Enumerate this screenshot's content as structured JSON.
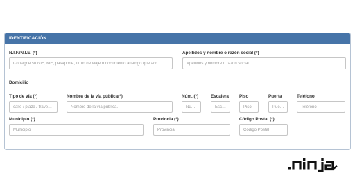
{
  "panel": {
    "title": "IDENTIFICACIÓN"
  },
  "fields": {
    "nif": {
      "label": "N.I.F./N.I.E. (*)",
      "placeholder": "Consigne su NIF, NIE, pasaporte, título de viaje o documento análogo que acr…"
    },
    "apellidos": {
      "label": "Apellidos y nombre o razón social (*)",
      "placeholder": "Apellidos y nombre o razón social"
    },
    "tipo_via": {
      "label": "Tipo de vía (*)",
      "placeholder": "calle / plaza / trave…"
    },
    "nombre_via": {
      "label": "Nombre de la vía pública(*)",
      "placeholder": "Nombre de la vía publica."
    },
    "num": {
      "label": "Núm. (*)",
      "placeholder": "Nú…"
    },
    "escalera": {
      "label": "Escalera",
      "placeholder": "Esc…"
    },
    "piso": {
      "label": "Piso",
      "placeholder": "Piso"
    },
    "puerta": {
      "label": "Puerta",
      "placeholder": "Pue…"
    },
    "telefono": {
      "label": "Teléfono",
      "placeholder": "Teléfono"
    },
    "municipio": {
      "label": "Municipio (*)",
      "placeholder": "Municipio"
    },
    "provincia": {
      "label": "Provincia (*)",
      "placeholder": "Provincia"
    },
    "codigo_postal": {
      "label": "Código Postal (*)",
      "placeholder": "Código Postal"
    }
  },
  "sections": {
    "domicilio": "Domicilio"
  },
  "logo": {
    "text": ".ninja",
    "color": "#111111"
  },
  "colors": {
    "header": "#4674a8",
    "border": "#c6c6c6"
  }
}
